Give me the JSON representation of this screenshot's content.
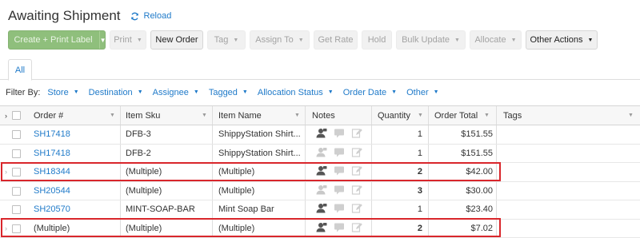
{
  "header": {
    "title": "Awaiting Shipment",
    "reload_label": "Reload"
  },
  "toolbar": {
    "create_label": "Create + Print Label",
    "print": "Print",
    "new_order": "New Order",
    "tag": "Tag",
    "assign_to": "Assign To",
    "get_rate": "Get Rate",
    "hold": "Hold",
    "bulk_update": "Bulk Update",
    "allocate": "Allocate",
    "other_actions": "Other Actions"
  },
  "tabs": {
    "all": "All"
  },
  "filters": {
    "label": "Filter By:",
    "items": [
      "Store",
      "Destination",
      "Assignee",
      "Tagged",
      "Allocation Status",
      "Order Date",
      "Other"
    ]
  },
  "columns": {
    "order": "Order #",
    "sku": "Item Sku",
    "name": "Item Name",
    "notes": "Notes",
    "quantity": "Quantity",
    "total": "Order Total",
    "tags": "Tags"
  },
  "rows": [
    {
      "order": "SH17418",
      "sku": "DFB-3",
      "name": "ShippyStation Shirt...",
      "qty": "1",
      "total": "$151.55"
    },
    {
      "order": "SH17418",
      "sku": "DFB-2",
      "name": "ShippyStation Shirt...",
      "qty": "1",
      "total": "$151.55"
    },
    {
      "order": "SH18344",
      "sku": "(Multiple)",
      "name": "(Multiple)",
      "qty": "2",
      "total": "$42.00"
    },
    {
      "order": "SH20544",
      "sku": "(Multiple)",
      "name": "(Multiple)",
      "qty": "3",
      "total": "$30.00"
    },
    {
      "order": "SH20570",
      "sku": "MINT-SOAP-BAR",
      "name": "Mint Soap Bar",
      "qty": "1",
      "total": "$23.40"
    },
    {
      "order": "(Multiple)",
      "sku": "(Multiple)",
      "name": "(Multiple)",
      "qty": "2",
      "total": "$7.02"
    }
  ],
  "colors": {
    "link": "#1f7ac9",
    "primary_button": "#8fbf7c",
    "highlight": "#d9262b"
  },
  "icons": {
    "reload": "refresh-icon",
    "notes": [
      "customer-note-icon",
      "message-icon",
      "edit-note-icon"
    ]
  }
}
